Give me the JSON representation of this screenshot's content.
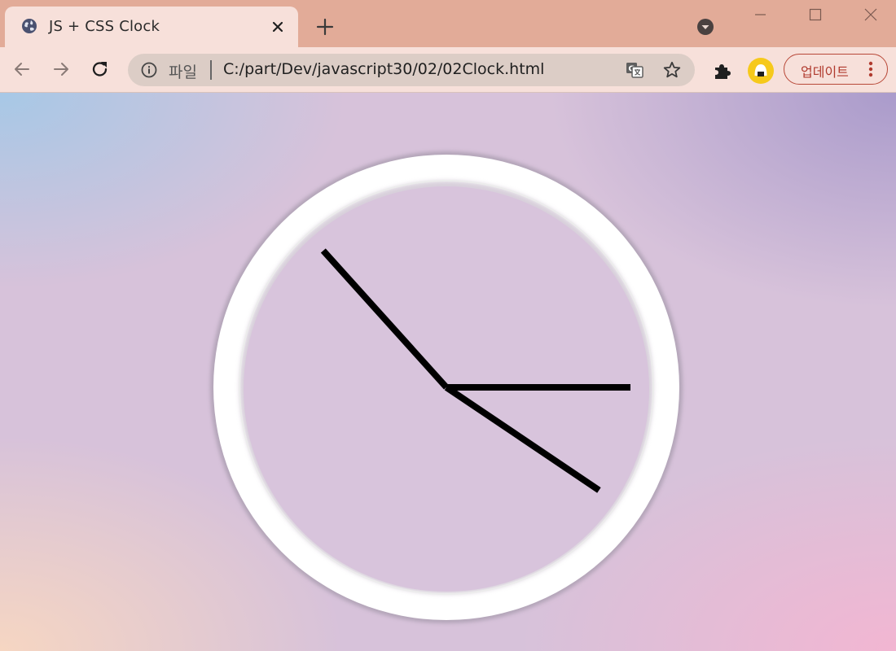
{
  "window": {
    "tab_title": "JS + CSS Clock"
  },
  "omnibox": {
    "scheme_label": "파일",
    "url": "C:/part/Dev/javascript30/02/02Clock.html"
  },
  "toolbar": {
    "update_label": "업데이트"
  },
  "icons": {
    "tab_favicon": "globe-icon",
    "tab_close": "close-icon",
    "new_tab": "plus-icon",
    "tab_search": "chevron-down-circle-icon",
    "back": "back-arrow-icon",
    "forward": "forward-arrow-icon",
    "reload": "reload-icon",
    "info": "info-icon",
    "translate": "translate-icon",
    "bookmark": "star-icon",
    "extensions": "puzzle-icon",
    "profile": "avatar-icon",
    "menu": "kebab-menu-icon"
  },
  "clock": {
    "hour_angle_deg": 90,
    "minute_angle_deg": 124,
    "second_angle_deg": 318,
    "hand_color": "#000000",
    "face_color": "#ffffff"
  },
  "colors": {
    "tabstrip": "#e2ab98",
    "toolbar": "#f7e0da",
    "accent_update": "#b03a2e"
  }
}
